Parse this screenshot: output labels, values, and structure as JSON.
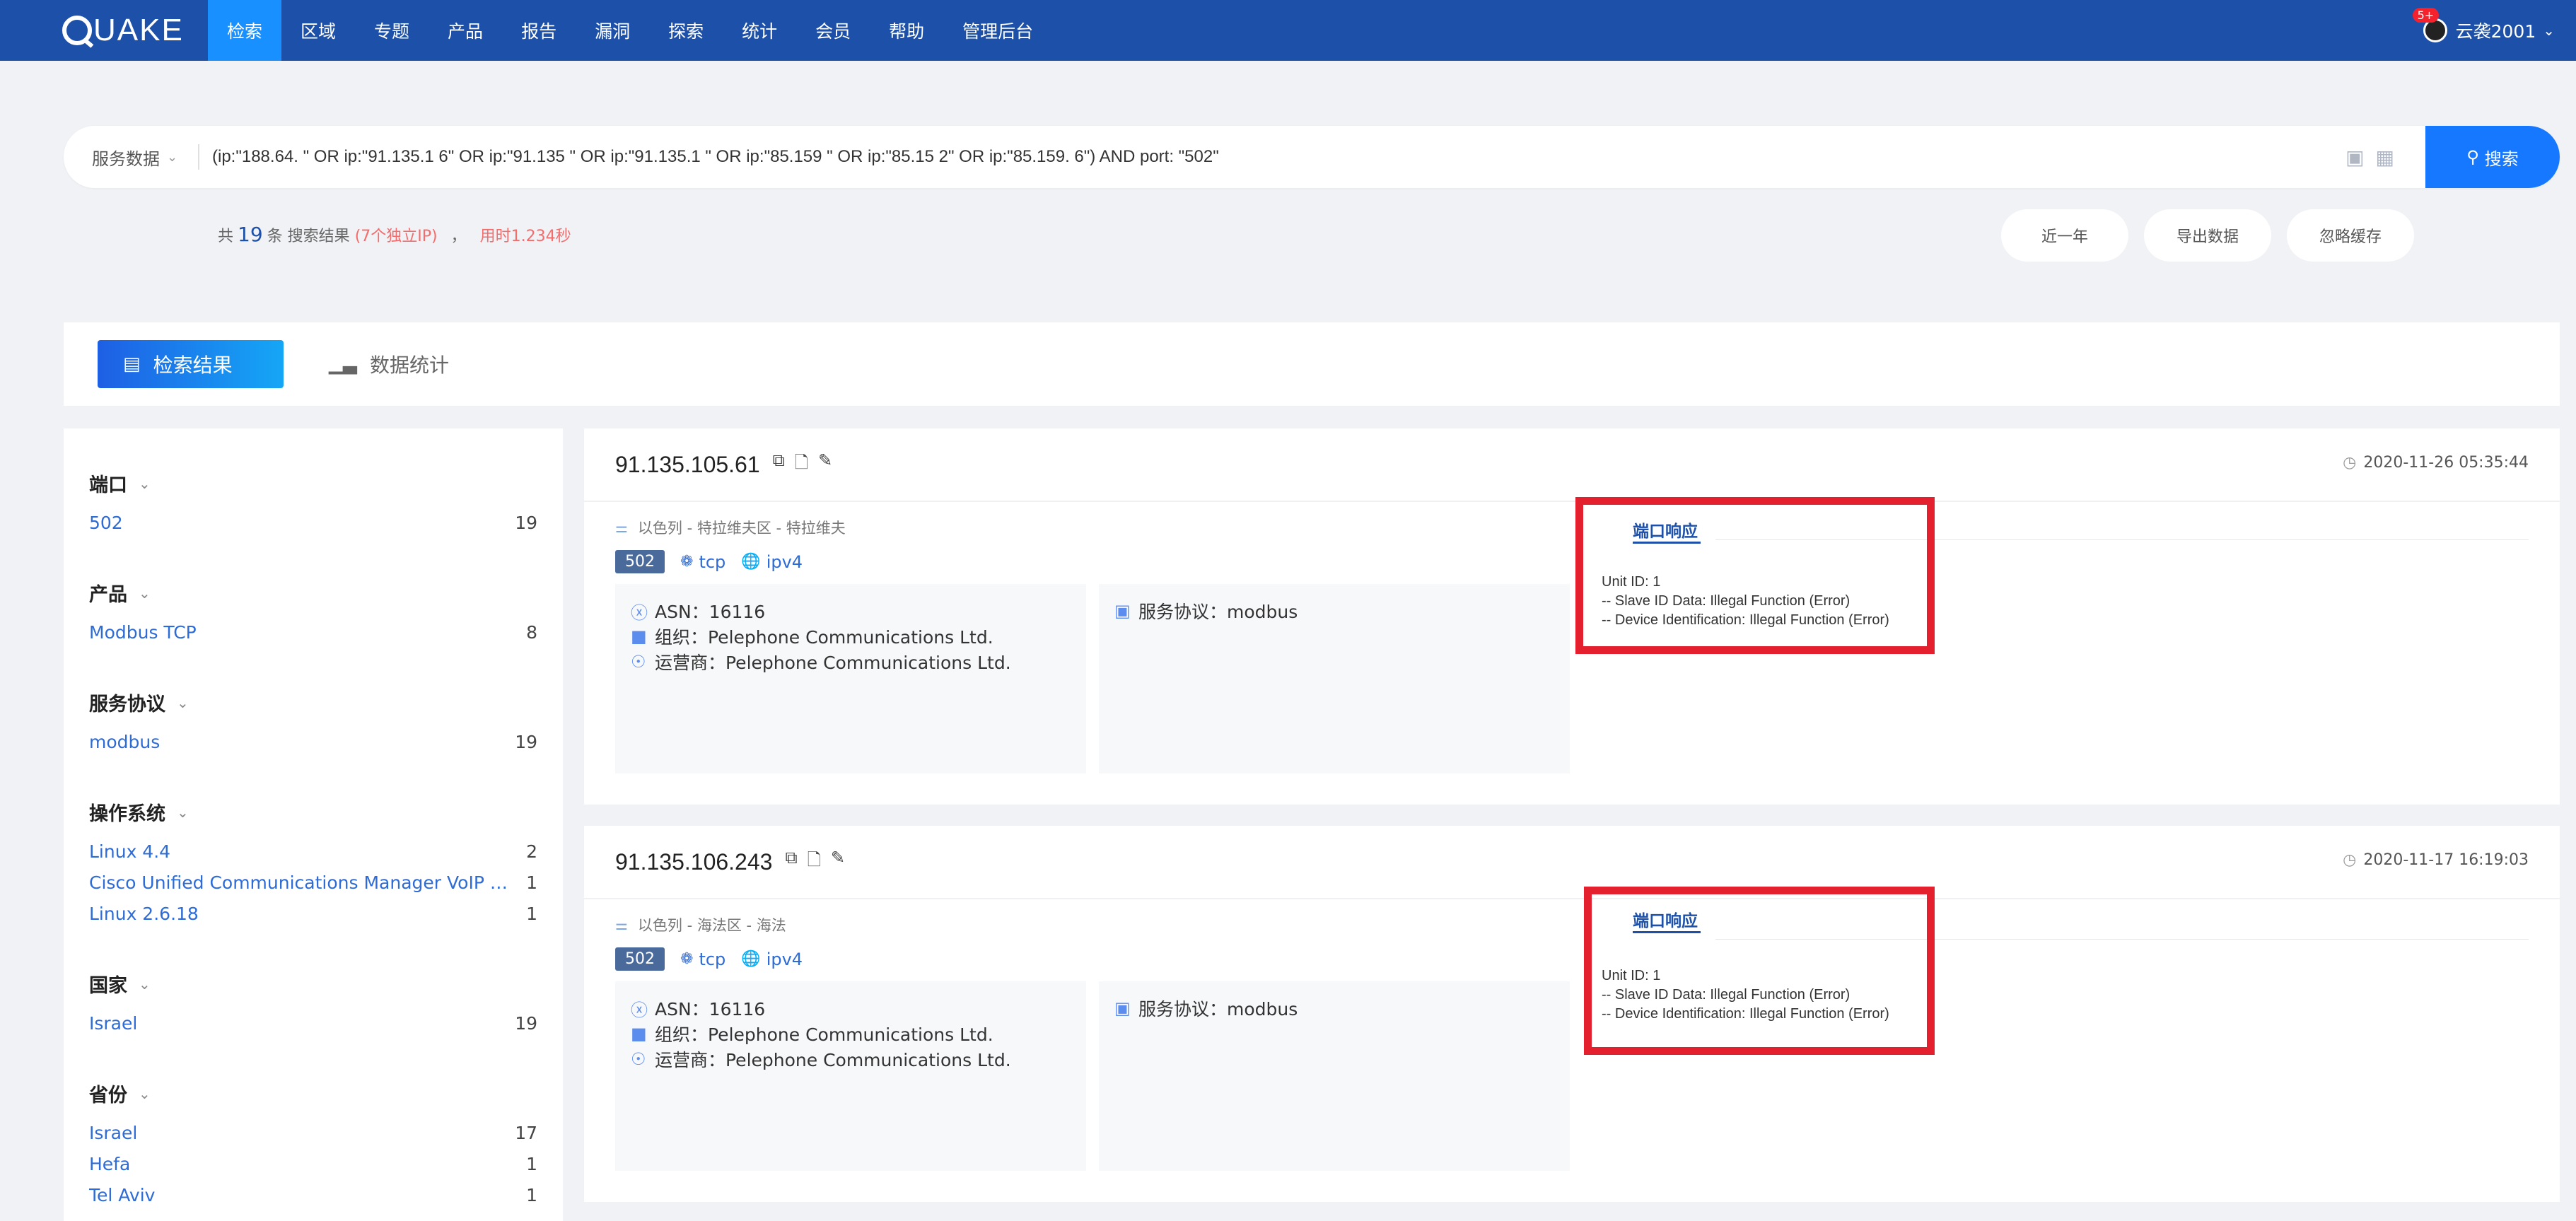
{
  "nav": {
    "logo": "UAKE",
    "items": [
      "检索",
      "区域",
      "专题",
      "产品",
      "报告",
      "漏洞",
      "探索",
      "统计",
      "会员",
      "帮助",
      "管理后台"
    ],
    "active_index": 0,
    "user": {
      "name": "云袭2001",
      "badge": "5+"
    }
  },
  "search": {
    "type": "服务数据",
    "query": "(ip:\"188.64.      \" OR ip:\"91.135.1      6\" OR ip:\"91.135      \" OR ip:\"91.135.1      \" OR ip:\"85.159      \" OR ip:\"85.15      2\" OR ip:\"85.159.      6\") AND port: \"502\"",
    "button": "搜索"
  },
  "summary": {
    "prefix": "共",
    "count": "19",
    "unit": "条",
    "label": "搜索结果",
    "ips": "(7个独立IP)",
    "sep": "，",
    "time": "用时1.234秒"
  },
  "tools": [
    "近一年",
    "导出数据",
    "忽略缓存"
  ],
  "tabs": [
    {
      "label": "检索结果",
      "icon": "list-icon"
    },
    {
      "label": "数据统计",
      "icon": "bar-chart-icon"
    }
  ],
  "facets": [
    {
      "title": "端口",
      "items": [
        {
          "name": "502",
          "count": "19"
        }
      ]
    },
    {
      "title": "产品",
      "items": [
        {
          "name": "Modbus TCP",
          "count": "8"
        }
      ]
    },
    {
      "title": "服务协议",
      "items": [
        {
          "name": "modbus",
          "count": "19"
        }
      ]
    },
    {
      "title": "操作系统",
      "items": [
        {
          "name": "Linux 4.4",
          "count": "2"
        },
        {
          "name": "Cisco Unified Communications Manager VoIP ada...",
          "count": "1"
        },
        {
          "name": "Linux 2.6.18",
          "count": "1"
        }
      ]
    },
    {
      "title": "国家",
      "items": [
        {
          "name": "Israel",
          "count": "19"
        }
      ]
    },
    {
      "title": "省份",
      "items": [
        {
          "name": "Israel",
          "count": "17"
        },
        {
          "name": "Hefa",
          "count": "1"
        },
        {
          "name": "Tel Aviv",
          "count": "1"
        }
      ]
    }
  ],
  "results": [
    {
      "ip": "91.135.105.61",
      "time": "2020-11-26 05:35:44",
      "location": "以色列 - 特拉维夫区 - 特拉维夫",
      "port": "502",
      "transport": "tcp",
      "ipver": "ipv4",
      "asn": "ASN：16116",
      "org": "组织：Pelephone Communications Ltd.",
      "isp": "运营商：Pelephone Communications Ltd.",
      "service": "服务协议：modbus",
      "response_title": "端口响应",
      "response": "Unit ID: 1\n-- Slave ID Data: Illegal Function (Error)\n-- Device Identification: Illegal Function (Error)"
    },
    {
      "ip": "91.135.106.243",
      "time": "2020-11-17 16:19:03",
      "location": "以色列 - 海法区 - 海法",
      "port": "502",
      "transport": "tcp",
      "ipver": "ipv4",
      "asn": "ASN：16116",
      "org": "组织：Pelephone Communications Ltd.",
      "isp": "运营商：Pelephone Communications Ltd.",
      "service": "服务协议：modbus",
      "response_title": "端口响应",
      "response": "Unit ID: 1\n-- Slave ID Data: Illegal Function (Error)\n-- Device Identification: Illegal Function (Error)"
    }
  ],
  "colors": {
    "nav_bg": "#1d50a8",
    "nav_active": "#1890ff",
    "accent": "#1677ff",
    "highlight": "#e5202e"
  }
}
